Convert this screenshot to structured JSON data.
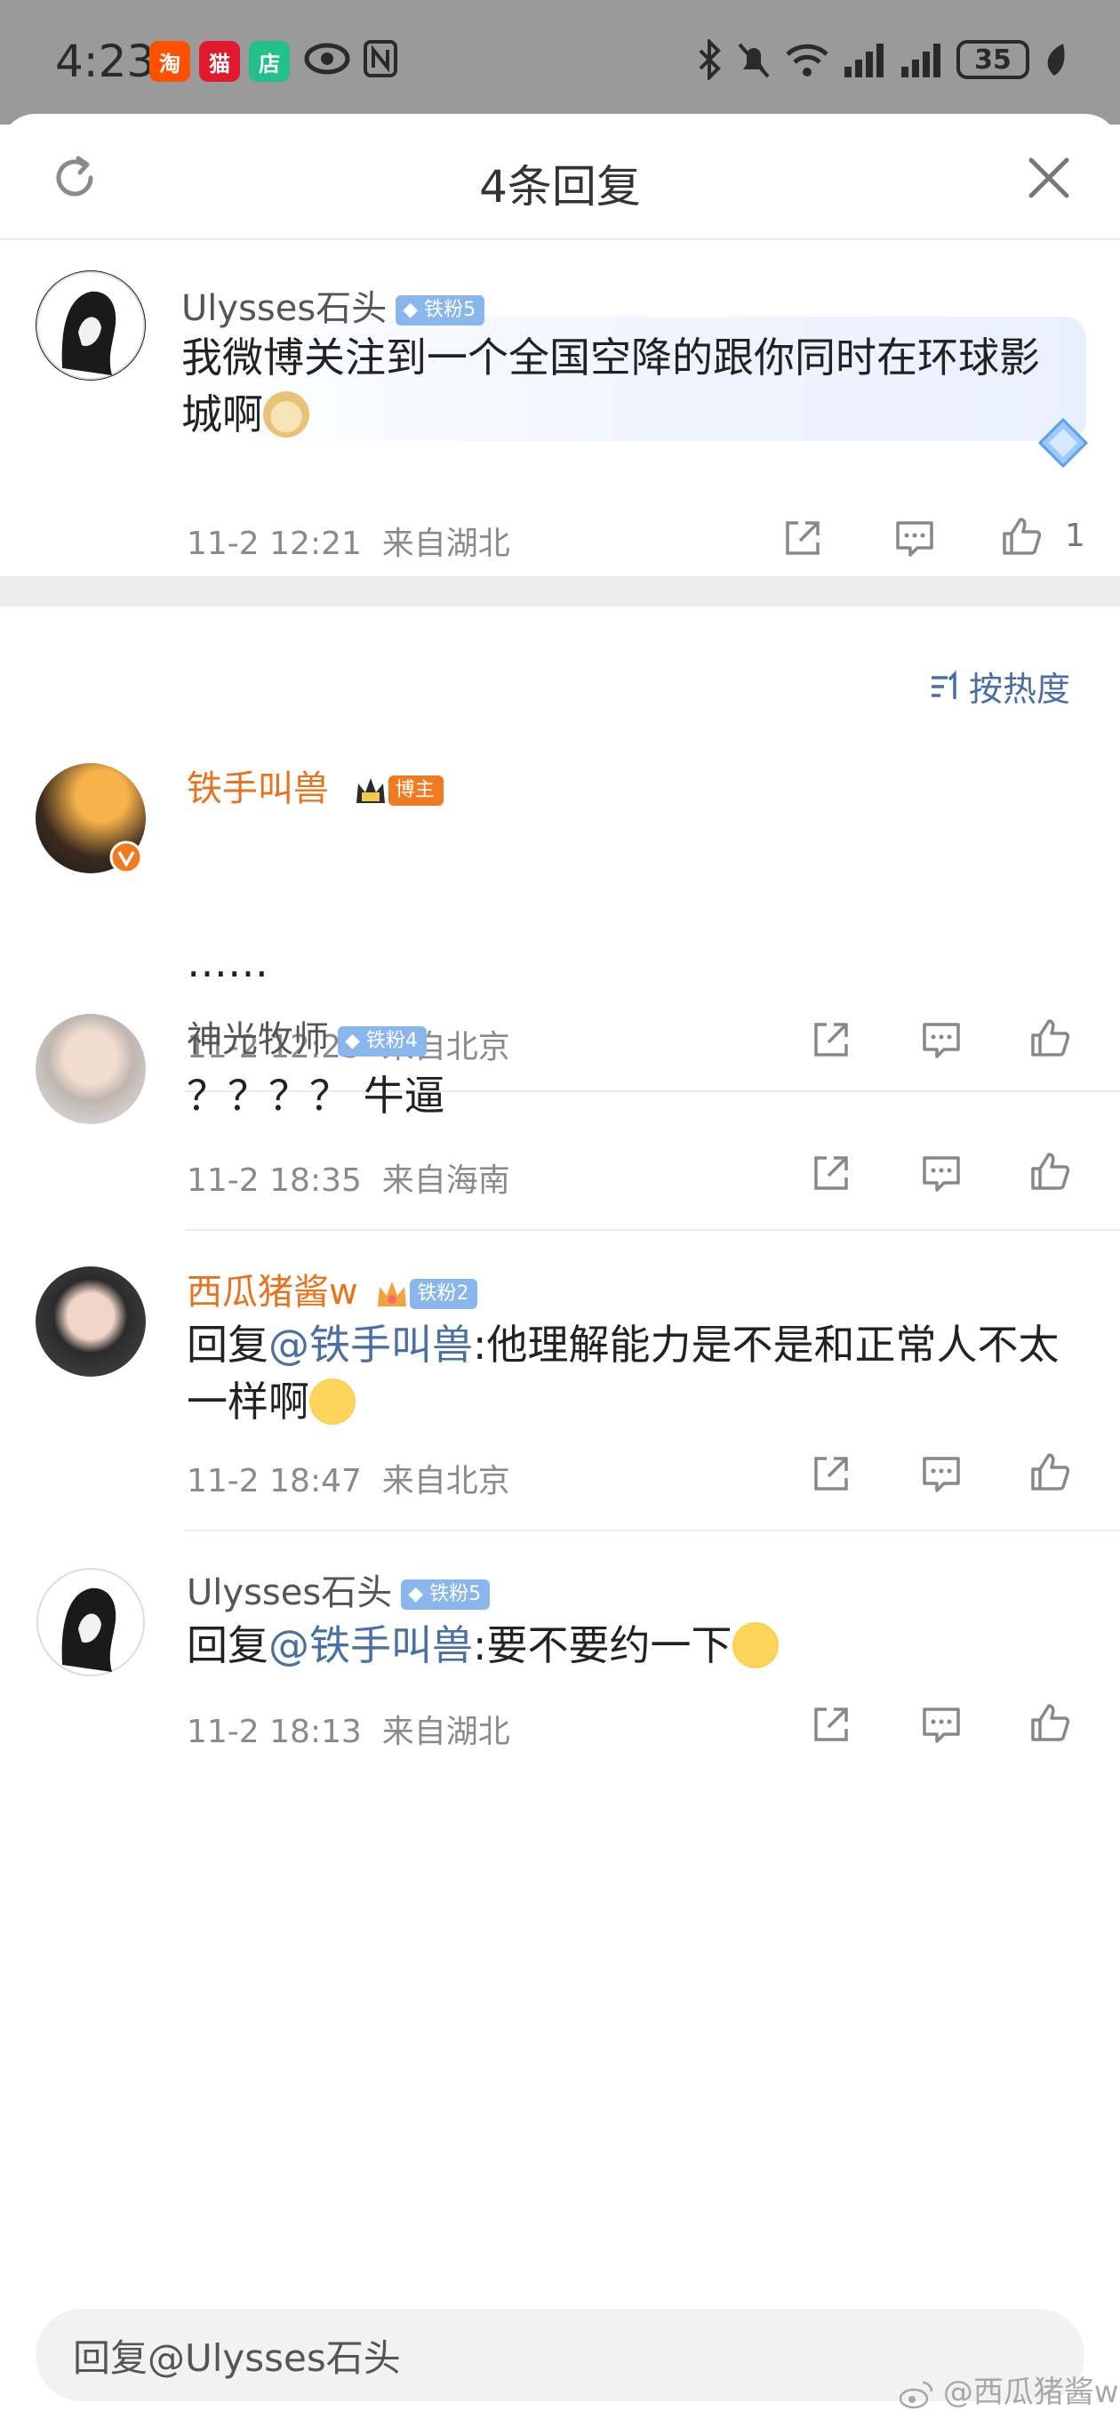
{
  "status_bar": {
    "time": "4:23",
    "apps": [
      {
        "icon": "taobao-icon",
        "label": "淘",
        "color": "#ff5000"
      },
      {
        "icon": "tmall-icon",
        "label": "猫",
        "color": "#e0192c"
      },
      {
        "icon": "shop-icon",
        "label": "店",
        "color": "#23c18a"
      }
    ],
    "battery": "35"
  },
  "header": {
    "title": "4条回复"
  },
  "root_comment": {
    "user": "Ulysses石头",
    "badge": "铁粉5",
    "text": "我微博关注到一个全国空降的跟你同时在环球影城啊",
    "time": "11-2 12:21",
    "location": "来自湖北",
    "likes": "1"
  },
  "sort": {
    "label": "按热度"
  },
  "replies": [
    {
      "user": "铁手叫兽",
      "badge": "博主",
      "user_color": "orange",
      "text": "……",
      "mention": "",
      "time": "11-2 12:23",
      "location": "来自北京"
    },
    {
      "user": "神光牧师",
      "badge": "铁粉4",
      "user_color": "gray",
      "text": "？？？？ 牛逼",
      "mention": "",
      "time": "11-2 18:35",
      "location": "来自海南"
    },
    {
      "user": "西瓜猪酱w",
      "badge": "铁粉2",
      "user_color": "orange",
      "prefix": "回复",
      "mention": "@铁手叫兽",
      "text": ":他理解能力是不是和正常人不太一样啊",
      "time": "11-2 18:47",
      "location": "来自北京"
    },
    {
      "user": "Ulysses石头",
      "badge": "铁粉5",
      "user_color": "gray",
      "prefix": "回复",
      "mention": "@铁手叫兽",
      "text": ":要不要约一下",
      "time": "11-2 18:13",
      "location": "来自湖北"
    }
  ],
  "input": {
    "placeholder": "回复@Ulysses石头"
  },
  "watermark": "@西瓜猪酱w"
}
